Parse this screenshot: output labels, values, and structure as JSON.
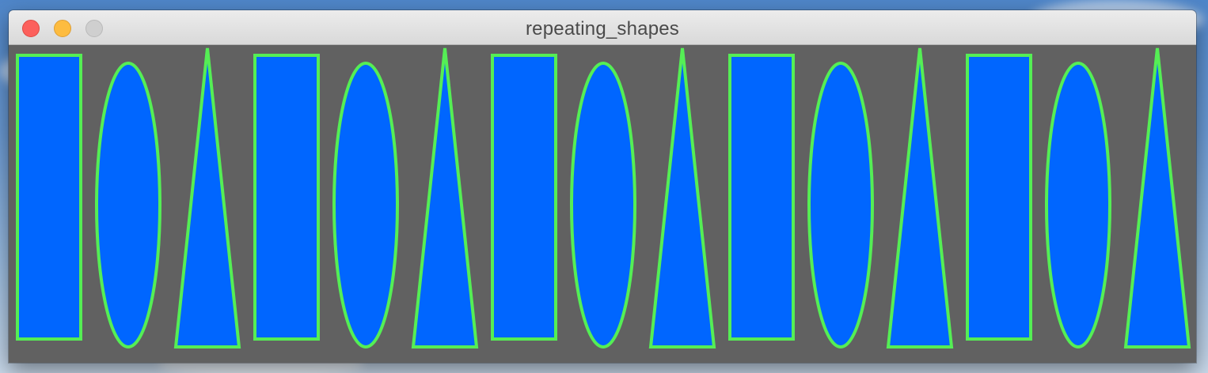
{
  "window": {
    "title": "repeating_shapes"
  },
  "title_bar_buttons": [
    "close",
    "minimize",
    "zoom"
  ],
  "canvas": {
    "background_color": "#616161",
    "fill_color": "#0066ff",
    "stroke_color": "#55ee55",
    "pattern": [
      "rectangle",
      "ellipse",
      "triangle"
    ],
    "repeat_count": 5
  }
}
